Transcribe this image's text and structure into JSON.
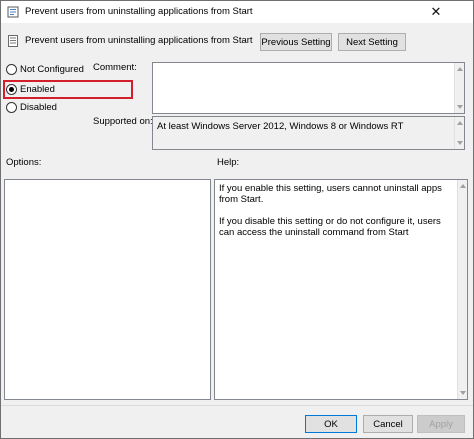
{
  "window": {
    "title": "Prevent users from uninstalling applications from Start",
    "close_glyph": "✕"
  },
  "header": {
    "policy_name": "Prevent users from uninstalling applications from Start",
    "previous_label": "Previous Setting",
    "next_label": "Next Setting"
  },
  "state": {
    "options": [
      {
        "label": "Not Configured",
        "checked": false
      },
      {
        "label": "Enabled",
        "checked": true
      },
      {
        "label": "Disabled",
        "checked": false
      }
    ]
  },
  "comment": {
    "label": "Comment:",
    "value": ""
  },
  "supported": {
    "label": "Supported on:",
    "value": "At least Windows Server 2012, Windows 8 or Windows RT"
  },
  "options_panel": {
    "label": "Options:"
  },
  "help_panel": {
    "label": "Help:",
    "paragraphs": [
      "If you enable this setting, users cannot uninstall apps from Start.",
      "If you disable this setting or do not configure it, users can access the uninstall command from Start"
    ]
  },
  "footer": {
    "ok_label": "OK",
    "cancel_label": "Cancel",
    "apply_label": "Apply"
  },
  "colors": {
    "highlight": "#d21f2b",
    "focus_border": "#0078d7"
  },
  "icons": {
    "title": "policy-settings-icon",
    "policy": "policy-document-icon"
  }
}
